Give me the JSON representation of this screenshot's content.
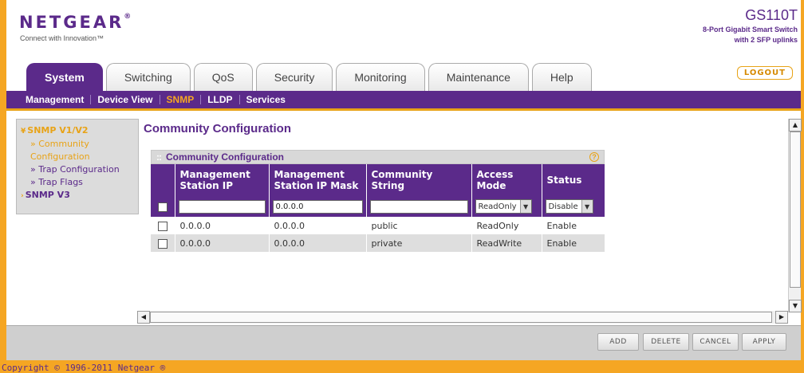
{
  "header": {
    "logo_text": "NETGEAR",
    "logo_mark": "®",
    "tagline": "Connect with Innovation™",
    "model_name": "GS110T",
    "model_desc_1": "8-Port Gigabit Smart Switch",
    "model_desc_2": "with 2 SFP uplinks",
    "logout_label": "LOGOUT"
  },
  "tabs": [
    {
      "label": "System"
    },
    {
      "label": "Switching"
    },
    {
      "label": "QoS"
    },
    {
      "label": "Security"
    },
    {
      "label": "Monitoring"
    },
    {
      "label": "Maintenance"
    },
    {
      "label": "Help"
    }
  ],
  "subnav": [
    {
      "label": "Management"
    },
    {
      "label": "Device View"
    },
    {
      "label": "SNMP"
    },
    {
      "label": "LLDP"
    },
    {
      "label": "Services"
    }
  ],
  "leftnav": {
    "group1": "SNMP V1/V2",
    "items": [
      "» Community",
      "Configuration",
      "» Trap Configuration",
      "» Trap Flags"
    ],
    "group2": "SNMP V3"
  },
  "main": {
    "title": "Community Configuration",
    "panel_title": "Community Configuration",
    "help_glyph": "?",
    "columns": [
      "Management Station IP",
      "Management Station IP Mask",
      "Community String",
      "Access Mode",
      "Status"
    ],
    "input_row": {
      "ip": "",
      "mask": "0.0.0.0",
      "community": "",
      "access": "ReadOnly",
      "status": "Disable"
    },
    "rows": [
      {
        "ip": "0.0.0.0",
        "mask": "0.0.0.0",
        "community": "public",
        "access": "ReadOnly",
        "status": "Enable"
      },
      {
        "ip": "0.0.0.0",
        "mask": "0.0.0.0",
        "community": "private",
        "access": "ReadWrite",
        "status": "Enable"
      }
    ]
  },
  "buttons": {
    "add": "ADD",
    "delete": "DELETE",
    "cancel": "CANCEL",
    "apply": "APPLY"
  },
  "footer": {
    "copyright": "Copyright © 1996-2011 Netgear ®"
  },
  "colors": {
    "brand_purple": "#5b2a8a",
    "accent_orange": "#e8a317"
  }
}
